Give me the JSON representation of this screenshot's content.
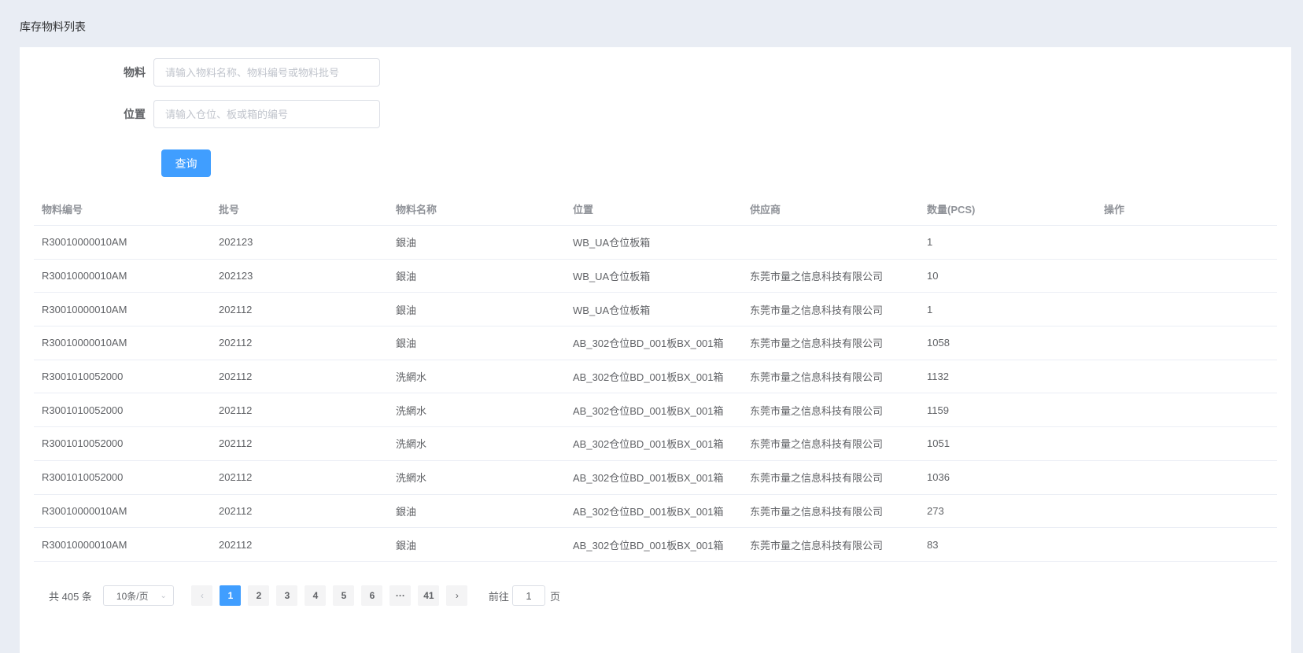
{
  "page": {
    "title": "库存物料列表"
  },
  "form": {
    "material": {
      "label": "物料",
      "value": "",
      "placeholder": "请输入物料名称、物料编号或物料批号"
    },
    "location": {
      "label": "位置",
      "value": "",
      "placeholder": "请输入仓位、板或箱的编号"
    },
    "query_label": "查询"
  },
  "table": {
    "headers": [
      "物料编号",
      "批号",
      "物料名称",
      "位置",
      "供应商",
      "数量(PCS)",
      "操作"
    ],
    "rows": [
      [
        "R30010000010AM",
        "202123",
        "銀油",
        "WB_UA仓位板箱",
        "",
        "1"
      ],
      [
        "R30010000010AM",
        "202123",
        "銀油",
        "WB_UA仓位板箱",
        "东莞市量之信息科技有限公司",
        "10"
      ],
      [
        "R30010000010AM",
        "202112",
        "銀油",
        "WB_UA仓位板箱",
        "东莞市量之信息科技有限公司",
        "1"
      ],
      [
        "R30010000010AM",
        "202112",
        "銀油",
        "AB_302仓位BD_001板BX_001箱",
        "东莞市量之信息科技有限公司",
        "1058"
      ],
      [
        "R3001010052000",
        "202112",
        "洗網水",
        "AB_302仓位BD_001板BX_001箱",
        "东莞市量之信息科技有限公司",
        "1132"
      ],
      [
        "R3001010052000",
        "202112",
        "洗網水",
        "AB_302仓位BD_001板BX_001箱",
        "东莞市量之信息科技有限公司",
        "1159"
      ],
      [
        "R3001010052000",
        "202112",
        "洗網水",
        "AB_302仓位BD_001板BX_001箱",
        "东莞市量之信息科技有限公司",
        "1051"
      ],
      [
        "R3001010052000",
        "202112",
        "洗網水",
        "AB_302仓位BD_001板BX_001箱",
        "东莞市量之信息科技有限公司",
        "1036"
      ],
      [
        "R30010000010AM",
        "202112",
        "銀油",
        "AB_302仓位BD_001板BX_001箱",
        "东莞市量之信息科技有限公司",
        "273"
      ],
      [
        "R30010000010AM",
        "202112",
        "銀油",
        "AB_302仓位BD_001板BX_001箱",
        "东莞市量之信息科技有限公司",
        "83"
      ]
    ]
  },
  "pagination": {
    "total_text": "共 405 条",
    "page_size": "10条/页",
    "prev_icon": "chevron-left-icon",
    "next_icon": "chevron-right-icon",
    "pages": [
      "1",
      "2",
      "3",
      "4",
      "5",
      "6",
      "···",
      "41"
    ],
    "current": "1",
    "goto_prefix": "前往",
    "goto_value": "1",
    "goto_suffix": "页"
  },
  "colors": {
    "accent": "#409eff",
    "background": "#e9edf4"
  }
}
